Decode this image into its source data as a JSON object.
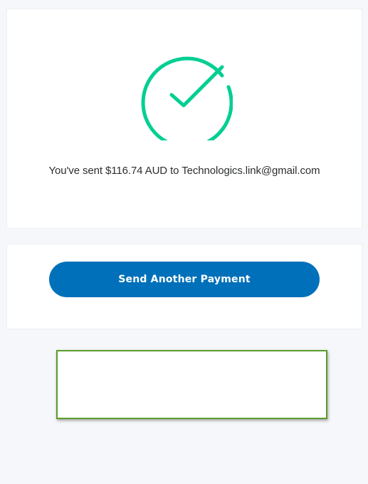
{
  "success": {
    "message": "You've sent $116.74 AUD to Technologics.link@gmail.com",
    "icon": "check-circle-icon",
    "accent_color": "#00cf92"
  },
  "actions": {
    "send_another_label": "Send Another Payment",
    "button_color": "#0070ba"
  },
  "highlight_box": {
    "border_color": "#5a9c2a"
  }
}
